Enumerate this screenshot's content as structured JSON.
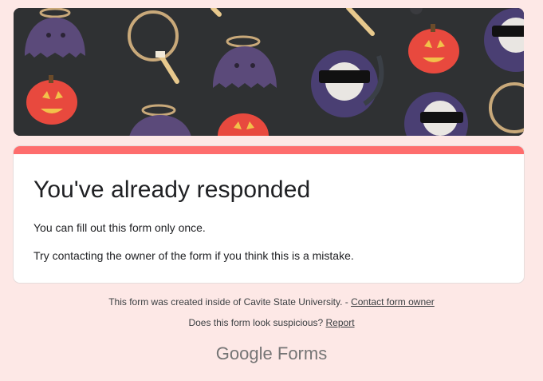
{
  "card": {
    "title": "You've already responded",
    "message": "You can fill out this form only once.",
    "hint": "Try contacting the owner of the form if you think this is a mistake."
  },
  "footer": {
    "created_text": "This form was created inside of Cavite State University. - ",
    "contact_link": "Contact form owner",
    "suspicious_text": "Does this form look suspicious? ",
    "report_link": "Report"
  },
  "brand": {
    "google": "Google",
    "forms": "Forms"
  },
  "colors": {
    "background": "#fde8e6",
    "accent": "#fe6d6d",
    "banner": "#2f3133"
  }
}
